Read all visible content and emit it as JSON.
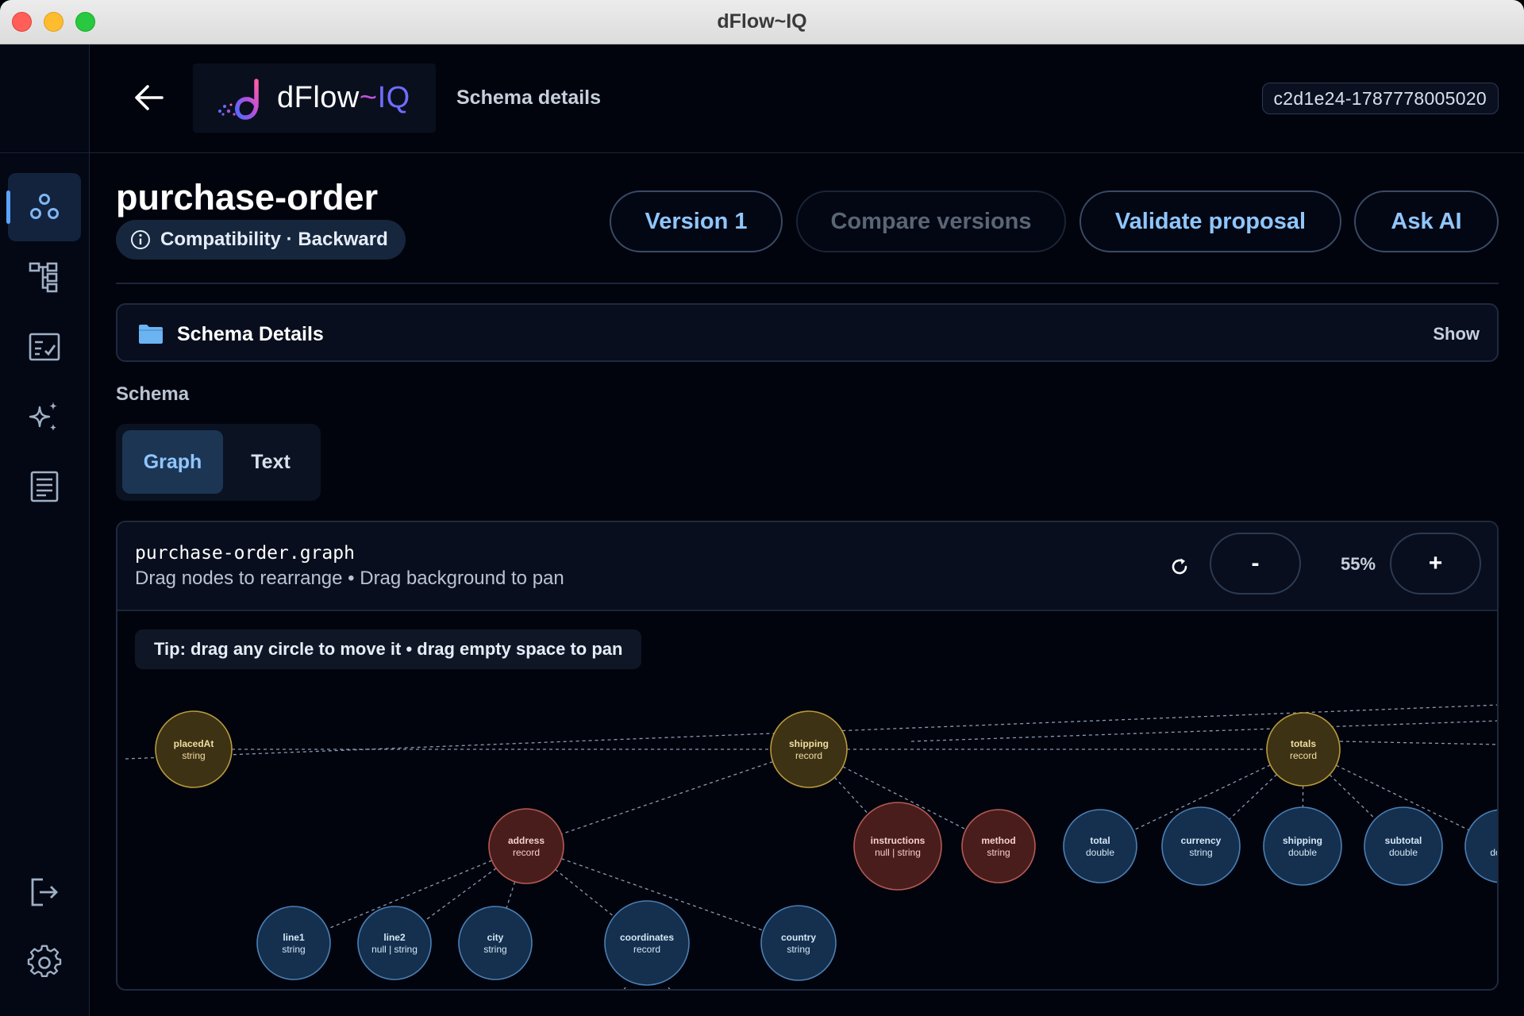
{
  "window": {
    "title": "dFlow~IQ"
  },
  "header": {
    "logo": {
      "brand": "dFlow",
      "tilde": "~",
      "suffix": "IQ"
    },
    "crumb": "Schema details",
    "schema_id": "c2d1e24-1787778005020"
  },
  "sidebar": {
    "items": [
      {
        "name": "schemas",
        "icon": "schema-nodes-icon",
        "active": true
      },
      {
        "name": "topology",
        "icon": "hierarchy-icon",
        "active": false
      },
      {
        "name": "validations",
        "icon": "checklist-icon",
        "active": false
      },
      {
        "name": "ai",
        "icon": "sparkles-icon",
        "active": false
      },
      {
        "name": "docs",
        "icon": "document-icon",
        "active": false
      }
    ],
    "bottom": [
      {
        "name": "logout",
        "icon": "logout-icon"
      },
      {
        "name": "settings",
        "icon": "gear-icon"
      }
    ]
  },
  "schema": {
    "title": "purchase-order",
    "compatibility": "Compatibility · Backward",
    "actions": {
      "version": "Version 1",
      "compare": "Compare versions",
      "validate": "Validate proposal",
      "ask_ai": "Ask AI"
    }
  },
  "details": {
    "title": "Schema Details",
    "toggle": "Show"
  },
  "schema_section": {
    "label": "Schema",
    "tabs": [
      "Graph",
      "Text"
    ],
    "selected_tab": "Graph"
  },
  "graph": {
    "file": "purchase-order.graph",
    "hint": "Drag nodes to rearrange • Drag background to pan",
    "zoom_out": "-",
    "zoom_in": "+",
    "zoom": "55%",
    "tip": "Tip: drag any circle to move it • drag empty space to pan",
    "colors": {
      "record_fill": "#3d3214",
      "record_stroke": "#b89a3c",
      "record_text": "#f2dfa2",
      "nested_fill": "#4a1d1d",
      "nested_stroke": "#b45a52",
      "nested_text": "#f4d0c8",
      "field_fill": "#14304e",
      "field_stroke": "#4a7fb5",
      "field_text": "#d6e6f7",
      "edge": "#8a9ab0"
    },
    "nodes": [
      {
        "id": "placedAt",
        "label": "placedAt",
        "type": "string",
        "kind": "record"
      },
      {
        "id": "shipping",
        "label": "shipping",
        "type": "record",
        "kind": "record"
      },
      {
        "id": "totals",
        "label": "totals",
        "type": "record",
        "kind": "record"
      },
      {
        "id": "address",
        "label": "address",
        "type": "record",
        "kind": "nested"
      },
      {
        "id": "instructions",
        "label": "instructions",
        "type": "null | string",
        "kind": "nested"
      },
      {
        "id": "method",
        "label": "method",
        "type": "string",
        "kind": "nested"
      },
      {
        "id": "total",
        "label": "total",
        "type": "double",
        "kind": "field"
      },
      {
        "id": "currency",
        "label": "currency",
        "type": "string",
        "kind": "field"
      },
      {
        "id": "shippingAmt",
        "label": "shipping",
        "type": "double",
        "kind": "field"
      },
      {
        "id": "subtotal",
        "label": "subtotal",
        "type": "double",
        "kind": "field"
      },
      {
        "id": "discount",
        "label": "",
        "type": "do",
        "kind": "field"
      },
      {
        "id": "line1",
        "label": "line1",
        "type": "string",
        "kind": "field"
      },
      {
        "id": "line2",
        "label": "line2",
        "type": "null | string",
        "kind": "field"
      },
      {
        "id": "city",
        "label": "city",
        "type": "string",
        "kind": "field"
      },
      {
        "id": "coordinates",
        "label": "coordinates",
        "type": "record",
        "kind": "field"
      },
      {
        "id": "country",
        "label": "country",
        "type": "string",
        "kind": "field"
      }
    ],
    "edges": [
      [
        "placedAt",
        "shipping"
      ],
      [
        "shipping",
        "totals"
      ],
      [
        "shipping",
        "address"
      ],
      [
        "shipping",
        "instructions"
      ],
      [
        "shipping",
        "method"
      ],
      [
        "totals",
        "total"
      ],
      [
        "totals",
        "currency"
      ],
      [
        "totals",
        "shippingAmt"
      ],
      [
        "totals",
        "subtotal"
      ],
      [
        "totals",
        "discount"
      ],
      [
        "address",
        "line1"
      ],
      [
        "address",
        "line2"
      ],
      [
        "address",
        "city"
      ],
      [
        "address",
        "coordinates"
      ],
      [
        "address",
        "country"
      ]
    ]
  }
}
